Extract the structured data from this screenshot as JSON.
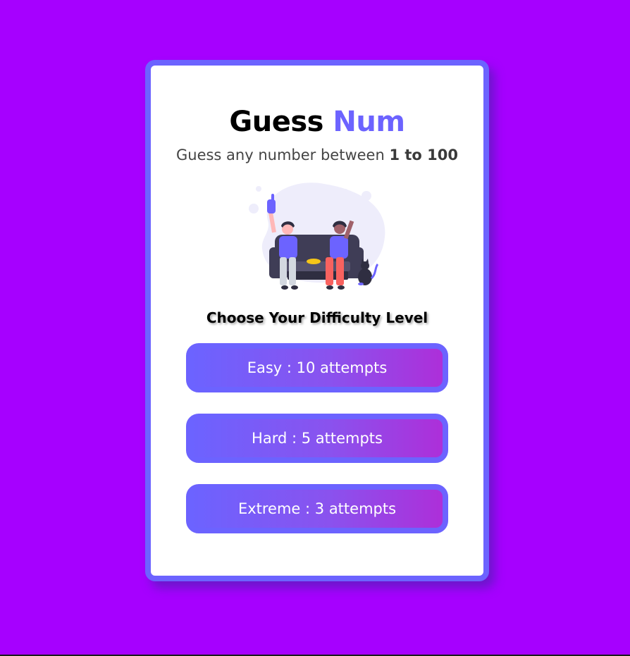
{
  "header": {
    "title_part1": "Guess",
    "title_part2": "Num",
    "subtitle_prefix": "Guess any number between ",
    "subtitle_range": "1 to 100"
  },
  "illustration": {
    "icon": "friends-on-couch-illustration"
  },
  "difficulty": {
    "heading": "Choose Your Difficulty Level",
    "options": [
      {
        "label": "Easy : 10 attempts"
      },
      {
        "label": "Hard : 5 attempts"
      },
      {
        "label": "Extreme : 3 attempts"
      }
    ]
  },
  "colors": {
    "background": "#a600ff",
    "accent": "#6c63ff",
    "button_gradient_end": "#ad2fd9",
    "card": "#ffffff"
  }
}
